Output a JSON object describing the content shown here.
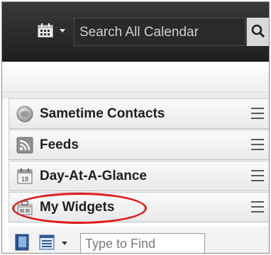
{
  "header": {
    "search_text": "Search All Calendar"
  },
  "panels": [
    {
      "label": "Sametime Contacts",
      "icon": "sametime-icon"
    },
    {
      "label": "Feeds",
      "icon": "feeds-icon"
    },
    {
      "label": "Day-At-A-Glance",
      "icon": "calendar-18-icon",
      "icon_text": "18"
    },
    {
      "label": "My Widgets",
      "icon": "widgets-icon",
      "highlighted": true
    }
  ],
  "toolbar": {
    "find_placeholder": "Type to Find"
  },
  "colors": {
    "highlight": "#e01a1a",
    "topbar": "#2a2a2a"
  }
}
